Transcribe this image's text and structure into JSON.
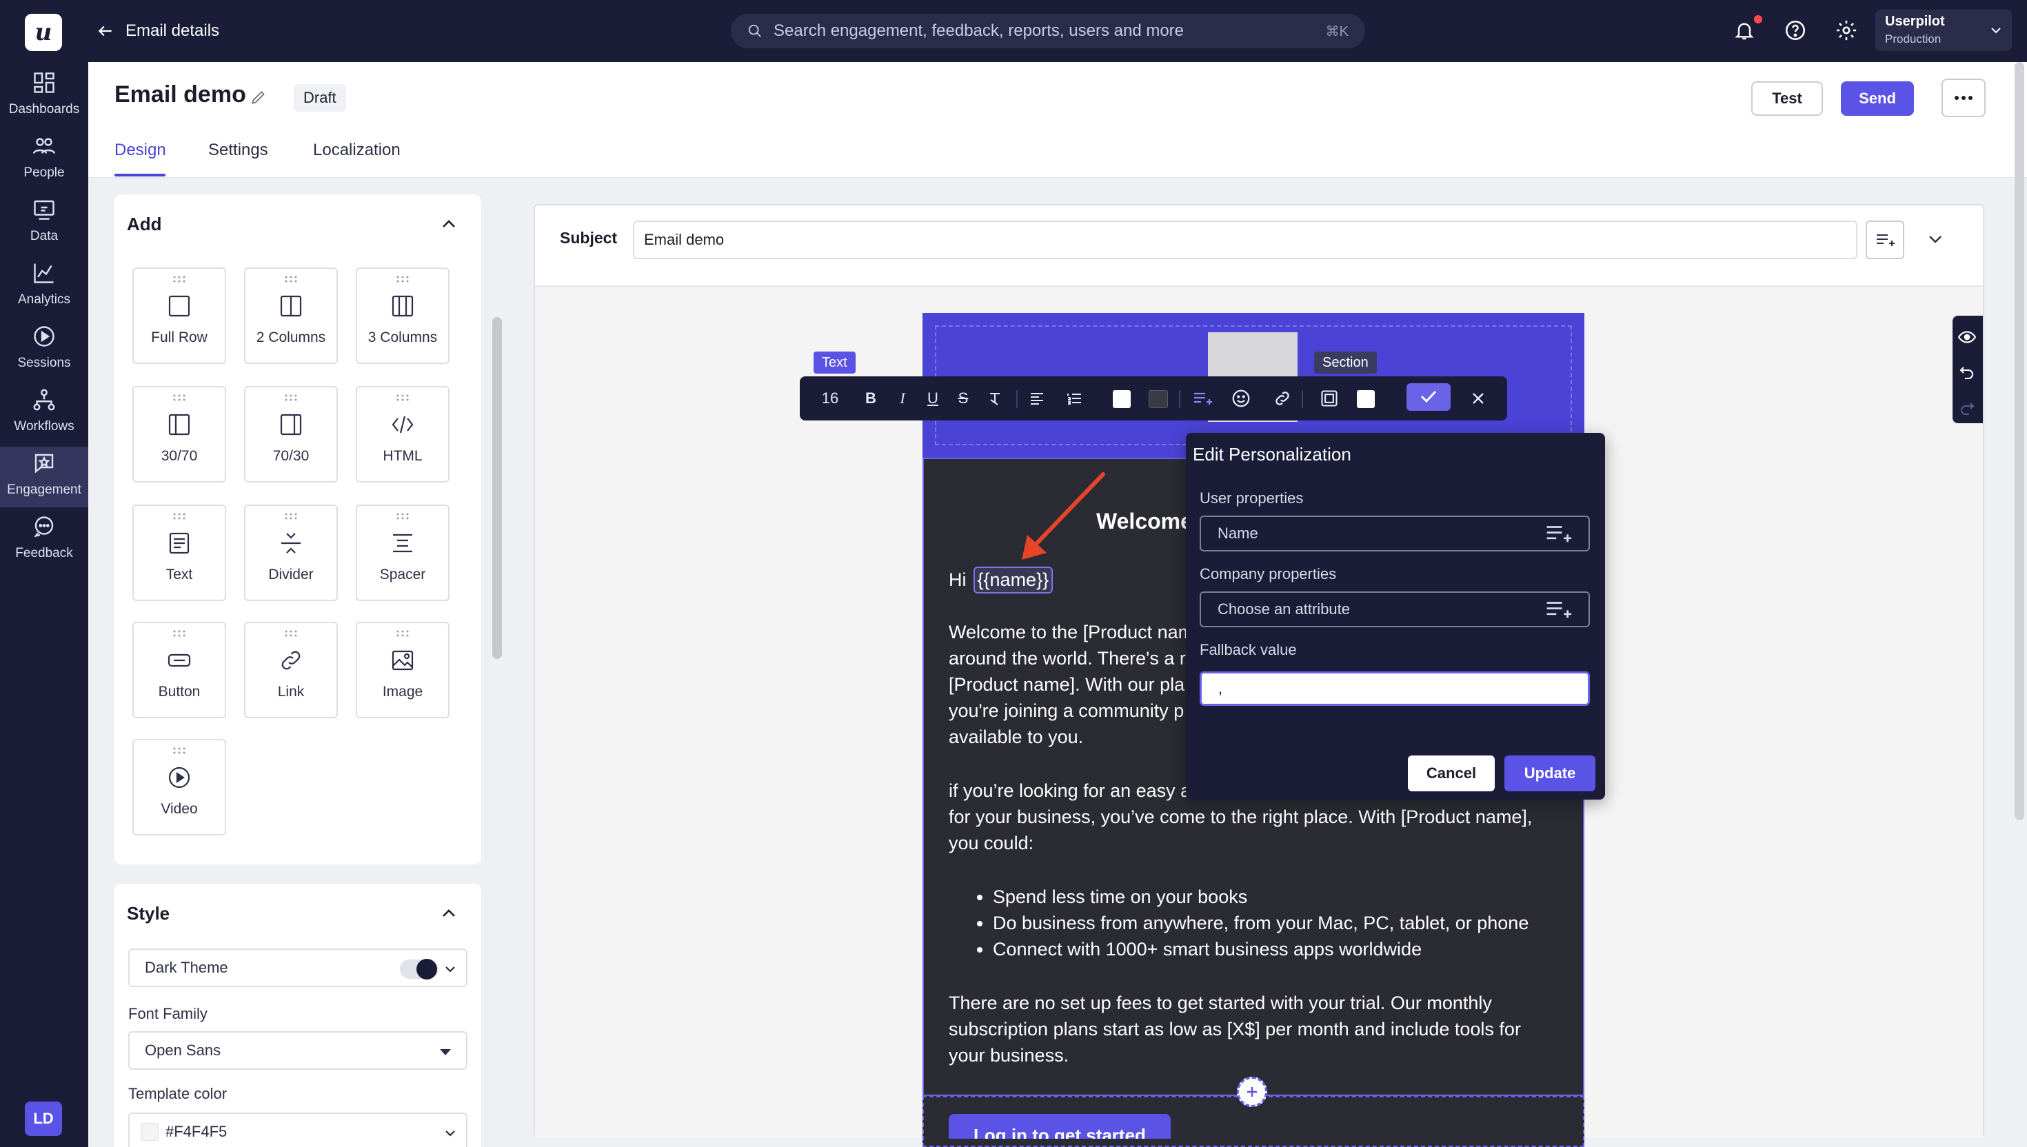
{
  "nav": {
    "logo": "u",
    "items": [
      {
        "label": "Dashboards",
        "icon": "dashboard-icon"
      },
      {
        "label": "People",
        "icon": "people-icon"
      },
      {
        "label": "Data",
        "icon": "data-icon"
      },
      {
        "label": "Analytics",
        "icon": "analytics-icon"
      },
      {
        "label": "Sessions",
        "icon": "sessions-icon"
      },
      {
        "label": "Workflows",
        "icon": "workflows-icon"
      },
      {
        "label": "Engagement",
        "icon": "engagement-icon",
        "active": true
      },
      {
        "label": "Feedback",
        "icon": "feedback-icon"
      }
    ],
    "avatar": "LD"
  },
  "topbar": {
    "back_label": "Email details",
    "search_placeholder": "Search engagement, feedback, reports, users and more",
    "search_shortcut": "⌘K",
    "account_name": "Userpilot",
    "account_env": "Production"
  },
  "header": {
    "title": "Email demo",
    "status": "Draft",
    "tabs": [
      "Design",
      "Settings",
      "Localization"
    ],
    "active_tab": "Design",
    "test_label": "Test",
    "send_label": "Send"
  },
  "add_panel": {
    "title": "Add",
    "blocks": [
      "Full Row",
      "2 Columns",
      "3 Columns",
      "30/70",
      "70/30",
      "HTML",
      "Text",
      "Divider",
      "Spacer",
      "Button",
      "Link",
      "Image",
      "Video"
    ]
  },
  "style_panel": {
    "title": "Style",
    "theme": "Dark Theme",
    "font_family_label": "Font Family",
    "font_family": "Open Sans",
    "template_color_label": "Template color",
    "template_color": "#F4F4F5"
  },
  "editor": {
    "subject_label": "Subject",
    "subject_value": "Email demo",
    "tag_text": "Text",
    "tag_section": "Section",
    "font_size": "16"
  },
  "email": {
    "heading": "Welcome",
    "greeting": "Hi",
    "token": "{{name}}",
    "para1_lines": [
      "Welcome to the [Product nam",
      "around the world. There's a r",
      "[Product name]. With our pla",
      "you're joining a community p",
      "available to you."
    ],
    "para2_lines": [
      "if you’re looking for an easy a",
      "for your business, you’ve come to the right place. With [Product name],",
      "you could:"
    ],
    "bullets": [
      "Spend less time on your books",
      "Do business from anywhere, from your Mac, PC, tablet, or phone",
      "Connect with 1000+ smart business apps worldwide"
    ],
    "para3_lines": [
      "There are no set up fees to get started with your trial. Our monthly",
      "subscription plans start as low as [X$] per month and include tools for",
      "your business."
    ],
    "cta": "Log in to get started"
  },
  "personalization": {
    "title": "Edit Personalization",
    "user_label": "User properties",
    "user_value": "Name",
    "company_label": "Company properties",
    "company_placeholder": "Choose an attribute",
    "fallback_label": "Fallback value",
    "fallback_value": ",",
    "cancel": "Cancel",
    "update": "Update"
  },
  "colors": {
    "brand": "#5b52e6",
    "nav_bg": "#1b1d38",
    "email_bg": "#2b2b33"
  }
}
